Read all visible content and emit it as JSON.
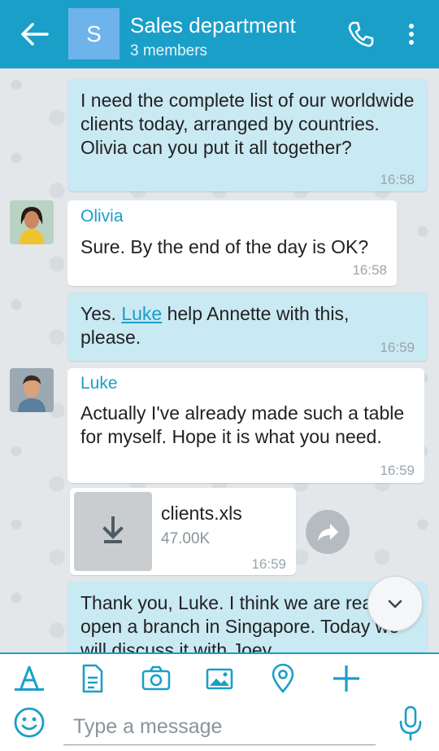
{
  "header": {
    "avatar_letter": "S",
    "title": "Sales department",
    "subtitle": "3 members"
  },
  "messages": [
    {
      "text": "I need the complete list of our worldwide clients today, arranged by countries.  Olivia can you put it all together?",
      "time": "16:58"
    },
    {
      "sender": "Olivia",
      "text": "Sure. By the end of the day is OK?",
      "time": "16:58"
    },
    {
      "text_before": "Yes. ",
      "mention": "Luke",
      "text_after": " help Annette with this, please.",
      "time": "16:59"
    },
    {
      "sender": "Luke",
      "text": "Actually I've already made such a table for myself. Hope it is what you need.",
      "time": "16:59"
    },
    {
      "file_name": "clients.xls",
      "file_size": "47.00K",
      "time": "16:59"
    },
    {
      "text": "Thank you, Luke. I think we are ready to open a branch in Singapore. Today we will discuss it with Joey"
    }
  ],
  "composer": {
    "placeholder": "Type a message"
  },
  "colors": {
    "accent": "#1a9fc9",
    "outgoing_bubble": "#c9e9f3",
    "incoming_bubble": "#ffffff"
  }
}
